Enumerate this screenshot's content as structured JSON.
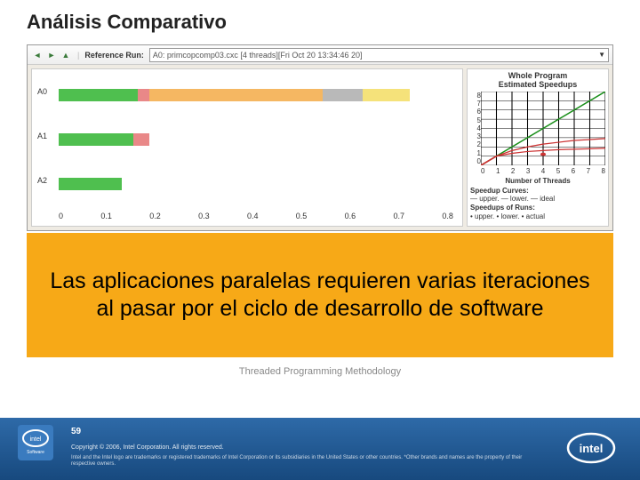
{
  "title": "Análisis Comparativo",
  "toolbar": {
    "ref_label": "Reference Run:",
    "dropdown_value": "A0: primcopcomp03.cxc [4 threads][Fri Oct 20 13:34:46 20]"
  },
  "bars": {
    "rows": [
      {
        "label": "A0",
        "segments": [
          {
            "cls": "g",
            "w": 20
          },
          {
            "cls": "r",
            "w": 3
          },
          {
            "cls": "o",
            "w": 44
          },
          {
            "cls": "s",
            "w": 10
          },
          {
            "cls": "y",
            "w": 12
          }
        ]
      },
      {
        "label": "A1",
        "segments": [
          {
            "cls": "g",
            "w": 19
          },
          {
            "cls": "r",
            "w": 4
          }
        ]
      },
      {
        "label": "A2",
        "segments": [
          {
            "cls": "g",
            "w": 16
          }
        ]
      }
    ],
    "xticks": [
      "0",
      "0.1",
      "0.2",
      "0.3",
      "0.4",
      "0.5",
      "0.6",
      "0.7",
      "0.8"
    ]
  },
  "speedup": {
    "title_line1": "Whole Program",
    "title_line2": "Estimated Speedups",
    "yticks": [
      "8",
      "7",
      "6",
      "5",
      "4",
      "3",
      "2",
      "1",
      "0"
    ],
    "xticks": [
      "0",
      "1",
      "2",
      "3",
      "4",
      "5",
      "6",
      "7",
      "8"
    ],
    "xlabel": "Number of Threads",
    "legend_title": "Speedup Curves:",
    "legend_line1": "— upper. — lower. — ideal",
    "legend_title2": "Speedups of Runs:",
    "legend_line2": "• upper. • lower. • actual"
  },
  "chart_data": {
    "ideal_line": {
      "x": [
        0,
        8
      ],
      "y": [
        0,
        8
      ]
    },
    "upper_line": {
      "x": [
        0,
        1,
        2,
        3,
        4,
        5,
        6,
        7,
        8
      ],
      "y": [
        0,
        1.0,
        1.6,
        2.0,
        2.3,
        2.5,
        2.7,
        2.8,
        2.9
      ]
    },
    "lower_line": {
      "x": [
        0,
        1,
        2,
        3,
        4,
        5,
        6,
        7,
        8
      ],
      "y": [
        0,
        1.0,
        1.3,
        1.5,
        1.6,
        1.7,
        1.75,
        1.8,
        1.85
      ]
    },
    "actual_points": [
      {
        "x": 4,
        "y": 1.2
      }
    ],
    "xlim": [
      0,
      8
    ],
    "ylim": [
      0,
      8
    ]
  },
  "orange_message": "Las aplicaciones paralelas requieren varias iteraciones al pasar por el ciclo de desarrollo de software",
  "subtitle": "Threaded Programming Methodology",
  "footer": {
    "page": "59",
    "copyright": "Copyright © 2006, Intel Corporation. All rights reserved.",
    "trademark": "Intel and the Intel logo are trademarks or registered trademarks of Intel Corporation or its subsidiaries in the United States or other countries. *Other brands and names are the property of their respective owners."
  }
}
